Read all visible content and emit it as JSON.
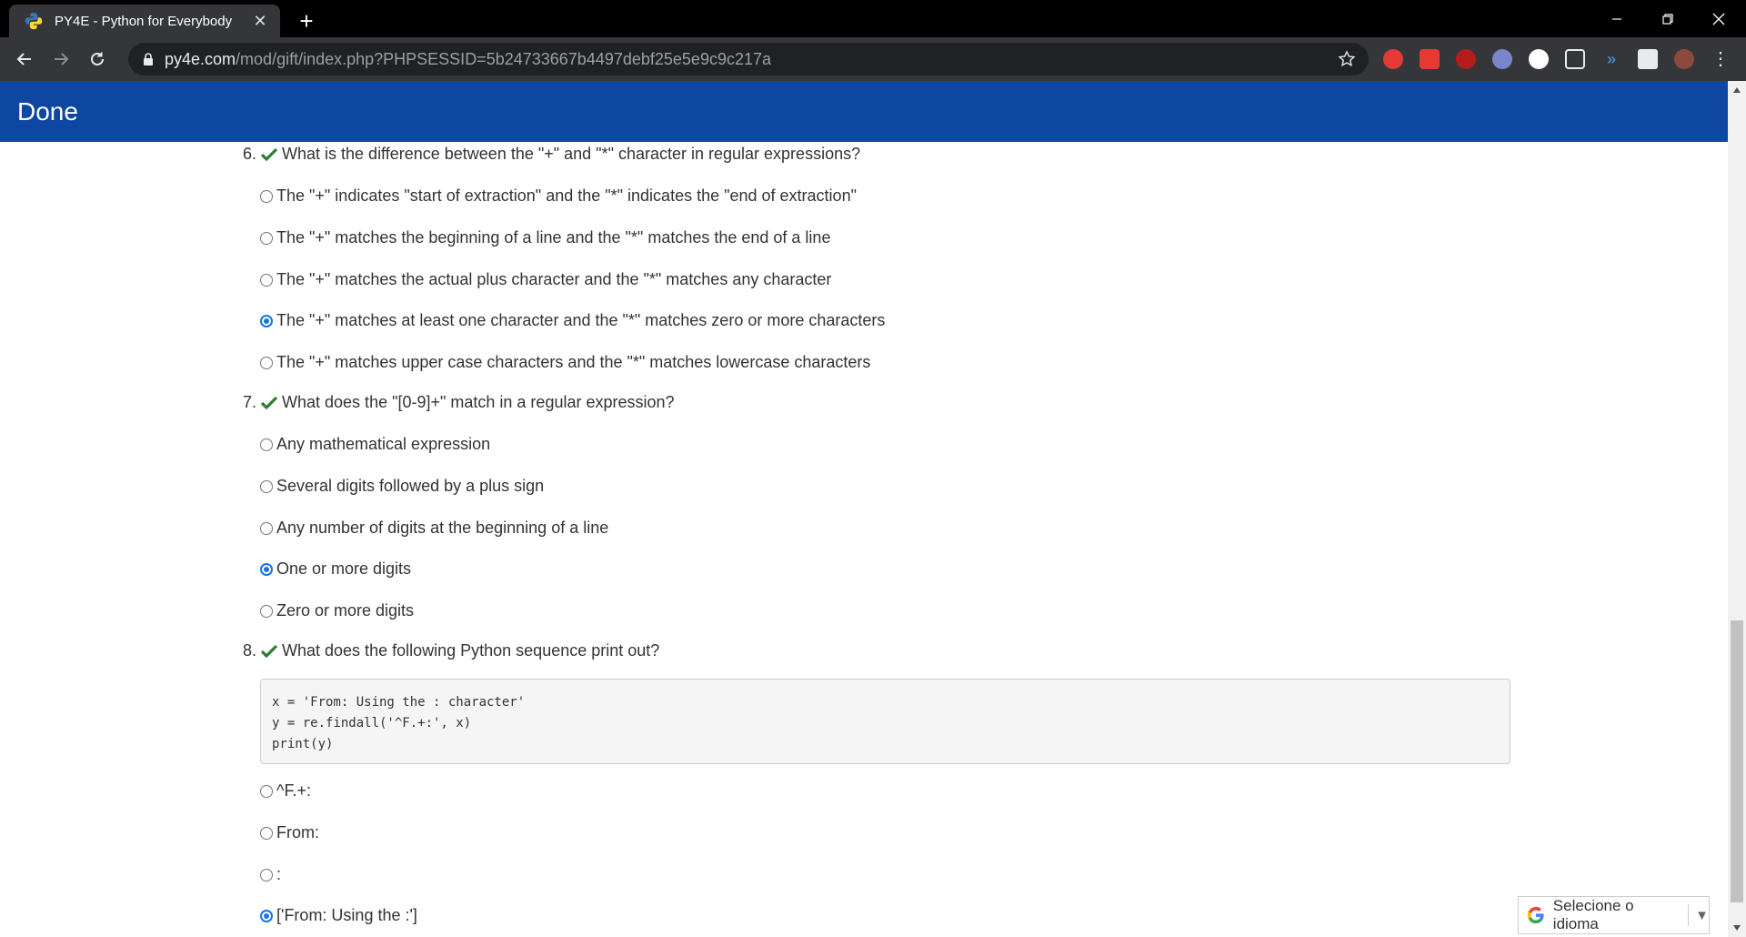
{
  "browser": {
    "tab_title": "PY4E - Python for Everybody",
    "tab_close": "✕",
    "new_tab": "+",
    "url_host": "py4e.com",
    "url_rest": "/mod/gift/index.php?PHPSESSID=5b24733667b4497debf25e5e9c9c217a"
  },
  "header": {
    "title": "Done"
  },
  "questions": [
    {
      "number": "6.",
      "text": "What is the difference between the \"+\" and \"*\" character in regular expressions?",
      "options": [
        "The \"+\" indicates \"start of extraction\" and the \"*\" indicates the \"end of extraction\"",
        "The \"+\" matches the beginning of a line and the \"*\" matches the end of a line",
        "The \"+\" matches the actual plus character and the \"*\" matches any character",
        "The \"+\" matches at least one character and the \"*\" matches zero or more characters",
        "The \"+\" matches upper case characters and the \"*\" matches lowercase characters"
      ],
      "selected": 3
    },
    {
      "number": "7.",
      "text": "What does the \"[0-9]+\" match in a regular expression?",
      "options": [
        "Any mathematical expression",
        "Several digits followed by a plus sign",
        "Any number of digits at the beginning of a line",
        "One or more digits",
        "Zero or more digits"
      ],
      "selected": 3
    },
    {
      "number": "8.",
      "text": "What does the following Python sequence print out?",
      "code": [
        "x = 'From: Using the : character'",
        "y = re.findall('^F.+:', x)",
        "print(y)"
      ],
      "options": [
        "^F.+:",
        "From:",
        ":",
        "['From: Using the :']"
      ],
      "selected": 3
    }
  ],
  "translate_widget": {
    "label": "Selecione o idioma",
    "arrow": "▼"
  },
  "colors": {
    "header_bg": "#0d47a1",
    "check_green": "#2e7d32",
    "radio_selected": "#1a73e8"
  }
}
